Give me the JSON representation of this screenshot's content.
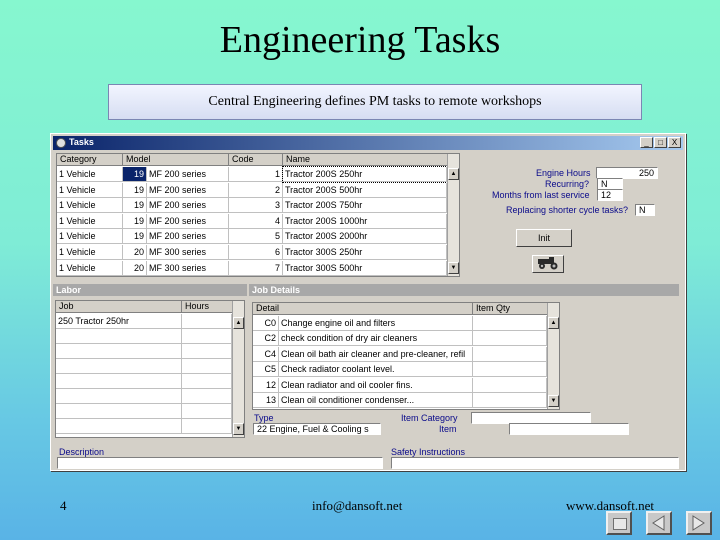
{
  "slide": {
    "title": "Engineering Tasks",
    "subtitle": "Central Engineering defines PM tasks to remote workshops",
    "page_number": "4",
    "email": "info@dansoft.net",
    "website": "www.dansoft.net"
  },
  "window": {
    "title": "Tasks",
    "minimize": "_",
    "maximize": "□",
    "close": "X"
  },
  "tasks_grid": {
    "headers": [
      "Category",
      "Model",
      "Code",
      "Name"
    ],
    "rows": [
      {
        "category": "1 Vehicle",
        "model_id": "19",
        "model": "MF 200 series",
        "code": "1",
        "name": "Tractor 200S 250hr"
      },
      {
        "category": "1 Vehicle",
        "model_id": "19",
        "model": "MF 200 series",
        "code": "2",
        "name": "Tractor 200S 500hr"
      },
      {
        "category": "1 Vehicle",
        "model_id": "19",
        "model": "MF 200 series",
        "code": "3",
        "name": "Tractor 200S 750hr"
      },
      {
        "category": "1 Vehicle",
        "model_id": "19",
        "model": "MF 200 series",
        "code": "4",
        "name": "Tractor 200S 1000hr"
      },
      {
        "category": "1 Vehicle",
        "model_id": "19",
        "model": "MF 200 series",
        "code": "5",
        "name": "Tractor 200S 2000hr"
      },
      {
        "category": "1 Vehicle",
        "model_id": "20",
        "model": "MF 300 series",
        "code": "6",
        "name": "Tractor 300S 250hr"
      },
      {
        "category": "1 Vehicle",
        "model_id": "20",
        "model": "MF 300 series",
        "code": "7",
        "name": "Tractor 300S 500hr"
      }
    ]
  },
  "right_panel": {
    "engine_hours_label": "Engine Hours",
    "engine_hours_value": "250",
    "recurring_label": "Recurring?",
    "recurring_value": "N",
    "months_label": "Months from last service",
    "months_value": "12",
    "replacing_label": "Replacing shorter cycle tasks?",
    "replacing_value": "N",
    "init_button": "Init"
  },
  "labor": {
    "panel_title": "Labor",
    "headers": [
      "Job",
      "Hours"
    ],
    "rows": [
      {
        "job": "250 Tractor 250hr",
        "hours": ""
      }
    ]
  },
  "job_details": {
    "panel_title": "Job Details",
    "headers": [
      "Detail",
      "Item Qty"
    ],
    "rows": [
      {
        "code": "C0",
        "detail": "Change engine oil and filters"
      },
      {
        "code": "C2",
        "detail": "check condition of dry air cleaners"
      },
      {
        "code": "C4",
        "detail": "Clean oil bath air cleaner and pre-cleaner, refil"
      },
      {
        "code": "C5",
        "detail": "Check radiator coolant level."
      },
      {
        "code": "12",
        "detail": "Clean radiator and oil cooler fins."
      },
      {
        "code": "13",
        "detail": "Clean oil conditioner condenser..."
      }
    ],
    "type_label": "Type",
    "type_value": "22 Engine, Fuel & Cooling s",
    "item_category_label": "Item Category",
    "item_label": "Item"
  },
  "bottom": {
    "description_label": "Description",
    "safety_label": "Safety Instructions"
  }
}
